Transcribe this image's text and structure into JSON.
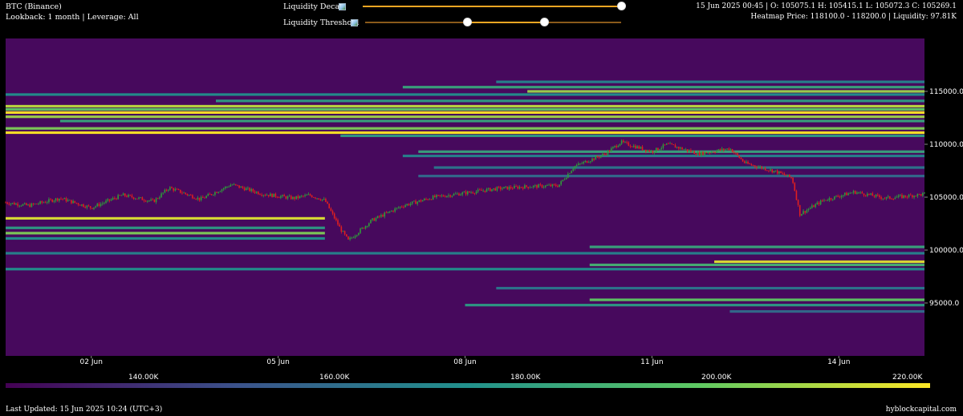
{
  "header": {
    "symbol": "BTC (Binance)",
    "lookback": "Lookback: 1 month | Leverage: All",
    "ohlc": "15 Jun 2025 00:45 | O: 105075.1 H: 105415.1 L: 105072.3 C: 105269.1",
    "heatmap_info": "Heatmap Price: 118100.0 - 118200.0 | Liquidity: 97.81K"
  },
  "controls": {
    "decay_label": "Liquidity Decay",
    "decay_value": 1.0,
    "threshold_label": "Liquidity Threshold",
    "threshold_range": [
      0.4,
      0.7
    ]
  },
  "colors": {
    "background": "#47095d",
    "candle_up": "#2e9d3a",
    "candle_down": "#e01f1f",
    "slider": "#f5a623",
    "viridis": [
      "#440154",
      "#3b528b",
      "#21918c",
      "#5ec962",
      "#fde725"
    ]
  },
  "footer": {
    "last_updated": "Last Updated: 15 Jun 2025 10:24 (UTC+3)",
    "brand": "hyblockcapital.com"
  },
  "colorbar": {
    "labels": [
      "140.00K",
      "160.00K",
      "180.00K",
      "200.00K",
      "220.00K"
    ]
  },
  "chart_data": {
    "type": "heatmap",
    "title": "",
    "x_tick_labels": [
      "02 Jun",
      "05 Jun",
      "08 Jun",
      "11 Jun",
      "14 Jun"
    ],
    "x_ticks": [
      "2025-06-02",
      "2025-06-05",
      "2025-06-08",
      "2025-06-11",
      "2025-06-14"
    ],
    "xlim": [
      "2025-05-31T15:00",
      "2025-06-15T09:00"
    ],
    "y_tick_labels": [
      "115000.0",
      "110000.0",
      "105000.0",
      "100000.0",
      "95000.0"
    ],
    "y_ticks": [
      115000,
      110000,
      105000,
      100000,
      95000
    ],
    "ylim": [
      90000,
      120000
    ],
    "liquidity_bands": [
      {
        "price": 115900,
        "start": "2025-06-08T12:00",
        "level": 0.45
      },
      {
        "price": 115400,
        "start": "2025-06-07T00:00",
        "level": 0.6
      },
      {
        "price": 115000,
        "start": "2025-06-09T00:00",
        "level": 0.85
      },
      {
        "price": 114700,
        "start": "2025-05-31T15:00",
        "level": 0.5
      },
      {
        "price": 114100,
        "start": "2025-06-04T00:00",
        "level": 0.55
      },
      {
        "price": 113600,
        "start": "2025-05-31T15:00",
        "level": 0.9
      },
      {
        "price": 113300,
        "start": "2025-05-31T15:00",
        "level": 0.75
      },
      {
        "price": 113000,
        "start": "2025-05-31T15:00",
        "level": 1.0
      },
      {
        "price": 112600,
        "start": "2025-05-31T15:00",
        "level": 0.85
      },
      {
        "price": 112200,
        "start": "2025-06-01T12:00",
        "level": 0.6
      },
      {
        "price": 111500,
        "start": "2025-05-31T15:00",
        "level": 0.8
      },
      {
        "price": 111100,
        "start": "2025-05-31T15:00",
        "level": 1.0
      },
      {
        "price": 110800,
        "start": "2025-06-06T00:00",
        "level": 0.55
      },
      {
        "price": 109300,
        "start": "2025-06-07T06:00",
        "level": 0.6
      },
      {
        "price": 108900,
        "start": "2025-06-07T00:00",
        "level": 0.45
      },
      {
        "price": 107800,
        "start": "2025-06-07T12:00",
        "level": 0.4
      },
      {
        "price": 107000,
        "start": "2025-06-07T06:00",
        "level": 0.35
      },
      {
        "price": 103000,
        "start": "2025-05-31T15:00",
        "end": "2025-06-05T18:00",
        "level": 0.95
      },
      {
        "price": 102100,
        "start": "2025-05-31T15:00",
        "end": "2025-06-05T18:00",
        "level": 0.55
      },
      {
        "price": 101600,
        "start": "2025-05-31T15:00",
        "end": "2025-06-05T18:00",
        "level": 0.8
      },
      {
        "price": 101100,
        "start": "2025-05-31T15:00",
        "end": "2025-06-05T18:00",
        "level": 0.5
      },
      {
        "price": 100300,
        "start": "2025-06-10T00:00",
        "level": 0.6
      },
      {
        "price": 99700,
        "start": "2025-05-31T15:00",
        "level": 0.45
      },
      {
        "price": 98900,
        "start": "2025-06-12T00:00",
        "level": 0.95
      },
      {
        "price": 98600,
        "start": "2025-06-10T00:00",
        "level": 0.65
      },
      {
        "price": 98200,
        "start": "2025-05-31T15:00",
        "level": 0.5
      },
      {
        "price": 96400,
        "start": "2025-06-08T12:00",
        "level": 0.4
      },
      {
        "price": 95300,
        "start": "2025-06-10T00:00",
        "level": 0.75
      },
      {
        "price": 94800,
        "start": "2025-06-08T00:00",
        "level": 0.55
      },
      {
        "price": 94200,
        "start": "2025-06-12T06:00",
        "level": 0.35
      }
    ],
    "price_path": [
      {
        "t": "2025-05-31T15:00",
        "p": 104500
      },
      {
        "t": "2025-06-01T00:00",
        "p": 104200
      },
      {
        "t": "2025-06-01T12:00",
        "p": 104900
      },
      {
        "t": "2025-06-02T00:00",
        "p": 104000
      },
      {
        "t": "2025-06-02T12:00",
        "p": 105200
      },
      {
        "t": "2025-06-03T00:00",
        "p": 104600
      },
      {
        "t": "2025-06-03T06:00",
        "p": 105900
      },
      {
        "t": "2025-06-03T18:00",
        "p": 104800
      },
      {
        "t": "2025-06-04T06:00",
        "p": 106200
      },
      {
        "t": "2025-06-04T18:00",
        "p": 105300
      },
      {
        "t": "2025-06-05T06:00",
        "p": 104900
      },
      {
        "t": "2025-06-05T12:00",
        "p": 105200
      },
      {
        "t": "2025-06-05T18:00",
        "p": 104700
      },
      {
        "t": "2025-06-06T00:00",
        "p": 102000
      },
      {
        "t": "2025-06-06T03:00",
        "p": 100900
      },
      {
        "t": "2025-06-06T12:00",
        "p": 102800
      },
      {
        "t": "2025-06-07T00:00",
        "p": 104200
      },
      {
        "t": "2025-06-07T12:00",
        "p": 105000
      },
      {
        "t": "2025-06-08T00:00",
        "p": 105400
      },
      {
        "t": "2025-06-08T12:00",
        "p": 105800
      },
      {
        "t": "2025-06-09T00:00",
        "p": 106000
      },
      {
        "t": "2025-06-09T12:00",
        "p": 106100
      },
      {
        "t": "2025-06-09T18:00",
        "p": 107900
      },
      {
        "t": "2025-06-10T06:00",
        "p": 109100
      },
      {
        "t": "2025-06-10T12:00",
        "p": 110200
      },
      {
        "t": "2025-06-11T00:00",
        "p": 109300
      },
      {
        "t": "2025-06-11T06:00",
        "p": 110000
      },
      {
        "t": "2025-06-11T18:00",
        "p": 109100
      },
      {
        "t": "2025-06-12T06:00",
        "p": 109600
      },
      {
        "t": "2025-06-12T12:00",
        "p": 108200
      },
      {
        "t": "2025-06-13T00:00",
        "p": 107400
      },
      {
        "t": "2025-06-13T06:00",
        "p": 106800
      },
      {
        "t": "2025-06-13T09:00",
        "p": 103400
      },
      {
        "t": "2025-06-13T18:00",
        "p": 104700
      },
      {
        "t": "2025-06-14T06:00",
        "p": 105500
      },
      {
        "t": "2025-06-14T18:00",
        "p": 104900
      },
      {
        "t": "2025-06-15T06:00",
        "p": 105200
      },
      {
        "t": "2025-06-15T09:00",
        "p": 105300
      }
    ]
  }
}
